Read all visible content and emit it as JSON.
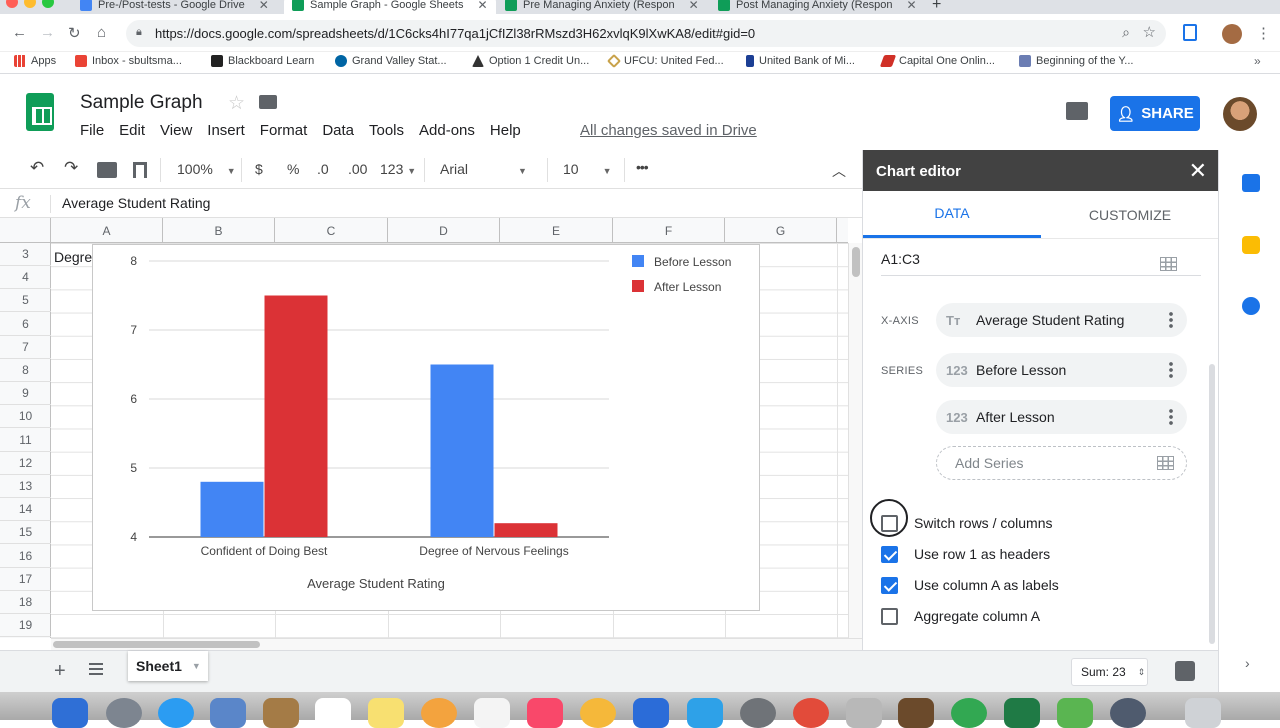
{
  "browser": {
    "tabs": [
      {
        "label": "Pre-/Post-tests - Google Drive",
        "color": "#4285f4"
      },
      {
        "label": "Sample Graph - Google Sheets",
        "color": "#0f9d58",
        "active": true
      },
      {
        "label": "Pre Managing Anxiety (Respon",
        "color": "#0f9d58"
      },
      {
        "label": "Post Managing Anxiety (Respon",
        "color": "#0f9d58"
      }
    ],
    "new_tab": "+",
    "url": "https://docs.google.com/spreadsheets/d/1C6cks4hI77qa1jCfIZl38rRMszd3H62xvlqK9lXwKA8/edit#gid=0",
    "bookmarks": [
      {
        "label": "Apps",
        "color": "#e94235"
      },
      {
        "label": "Inbox - sbultsma...",
        "color": "#ea4335"
      },
      {
        "label": "Blackboard Learn",
        "color": "#222222"
      },
      {
        "label": "Grand Valley Stat...",
        "color": "#0065a4"
      },
      {
        "label": "Option 1 Credit Un...",
        "color": "#333333"
      },
      {
        "label": "UFCU: United Fed...",
        "color": "#c8a24a"
      },
      {
        "label": "United Bank of Mi...",
        "color": "#1c3f94"
      },
      {
        "label": "Capital One Onlin...",
        "color": "#d03027"
      },
      {
        "label": "Beginning of the Y...",
        "color": "#6b7db3"
      }
    ]
  },
  "sheets": {
    "title": "Sample Graph",
    "menus": [
      "File",
      "Edit",
      "View",
      "Insert",
      "Format",
      "Data",
      "Tools",
      "Add-ons",
      "Help"
    ],
    "saved_status": "All changes saved in Drive",
    "share_label": "SHARE",
    "toolbar": {
      "zoom": "100%",
      "currency": "$",
      "percent": "%",
      "dec_less": ".0",
      "dec_more": ".00",
      "format_num": "123",
      "font": "Arial",
      "font_size": "10",
      "more": "•••"
    },
    "formula_label": "fx",
    "formula_value": "Average Student Rating",
    "columns": [
      "A",
      "B",
      "C",
      "D",
      "E",
      "F",
      "G"
    ],
    "rows": [
      "3",
      "4",
      "5",
      "6",
      "7",
      "8",
      "9",
      "10",
      "11",
      "12",
      "13",
      "14",
      "15",
      "16",
      "17",
      "18",
      "19"
    ],
    "cell_a3": "Degre",
    "sheet_tab": "Sheet1",
    "sum": "Sum: 23"
  },
  "chart_data": {
    "type": "bar",
    "categories": [
      "Confident of Doing Best",
      "Degree of Nervous Feelings"
    ],
    "series": [
      {
        "name": "Before Lesson",
        "values": [
          4.8,
          6.5
        ],
        "color": "#4285f4"
      },
      {
        "name": "After Lesson",
        "values": [
          7.5,
          4.2
        ],
        "color": "#db3236"
      }
    ],
    "xlabel": "Average Student Rating",
    "ylim": [
      4,
      8
    ],
    "yticks": [
      4,
      5,
      6,
      7,
      8
    ],
    "grid": true,
    "legend": "right"
  },
  "editor": {
    "title": "Chart editor",
    "tabs": [
      "DATA",
      "CUSTOMIZE"
    ],
    "data_range": "A1:C3",
    "xaxis_label": "X-AXIS",
    "xaxis_value": "Average Student Rating",
    "series_label": "SERIES",
    "series": [
      "Before Lesson",
      "After Lesson"
    ],
    "add_series": "Add Series",
    "text_icon": "Tт",
    "num_icon": "123",
    "checkboxes": [
      {
        "label": "Switch rows / columns",
        "checked": false
      },
      {
        "label": "Use row 1 as headers",
        "checked": true
      },
      {
        "label": "Use column A as labels",
        "checked": true
      },
      {
        "label": "Aggregate column A",
        "checked": false
      }
    ]
  }
}
